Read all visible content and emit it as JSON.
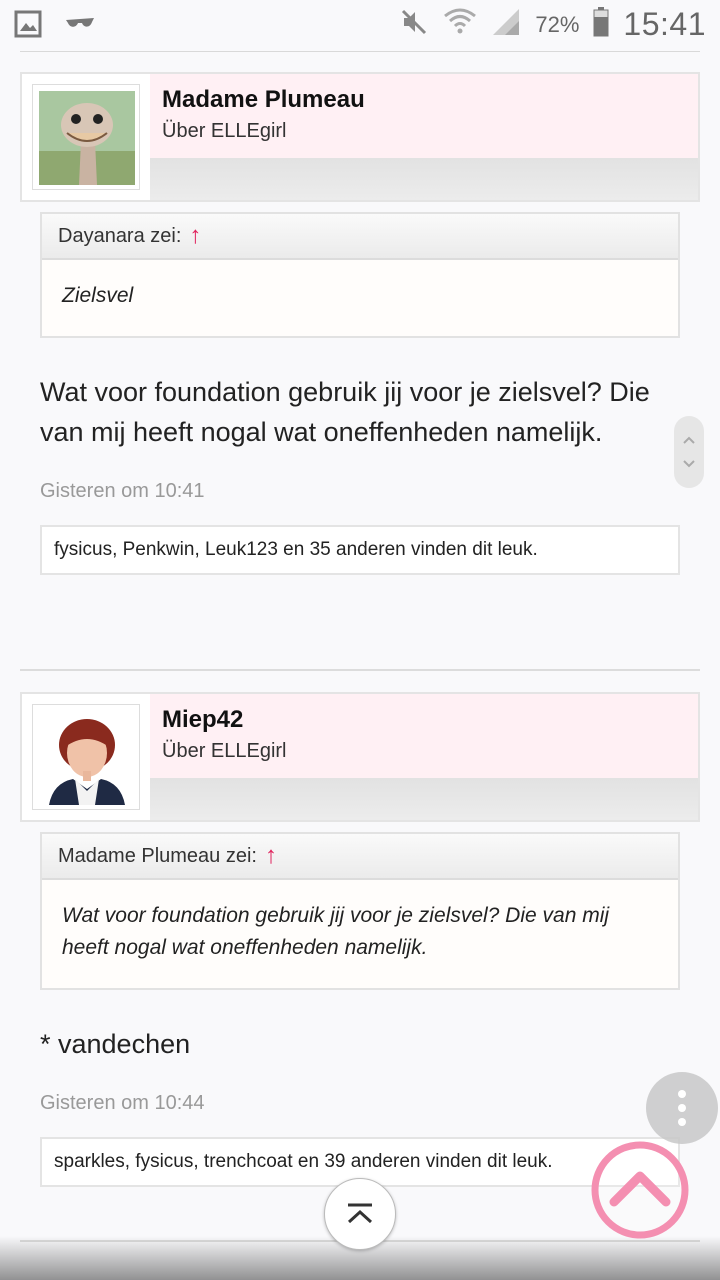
{
  "status_bar": {
    "battery": "72%",
    "time": "15:41",
    "icons": [
      "gallery-icon",
      "glasses-icon",
      "mute-icon",
      "wifi-icon",
      "signal-icon",
      "battery-icon"
    ]
  },
  "posts": [
    {
      "author": "Madame Plumeau",
      "subtitle": "Über ELLEgirl",
      "quote_author": "Dayanara zei:",
      "quote_text": "Zielsvel",
      "text": "Wat voor foundation gebruik jij voor je zielsvel? Die van mij heeft nogal wat oneffenheden namelijk.",
      "time": "Gisteren om 10:41",
      "likes": "fysicus, Penkwin, Leuk123 en 35 anderen vinden dit leuk."
    },
    {
      "author": "Miep42",
      "subtitle": "Über ELLEgirl",
      "quote_author": "Madame Plumeau zei:",
      "quote_text": "Wat voor foundation gebruik jij voor je zielsvel? Die van mij heeft nogal wat oneffenheden namelijk.",
      "text": "* vandechen",
      "time": "Gisteren om 10:44",
      "likes": "sparkles, fysicus, trenchcoat en 39 anderen vinden dit leuk."
    }
  ],
  "quote_arrow": "↑",
  "colors": {
    "accent_pink": "#e0245e",
    "author_bg": "#fff0f4",
    "up_button": "#f48fb1"
  }
}
